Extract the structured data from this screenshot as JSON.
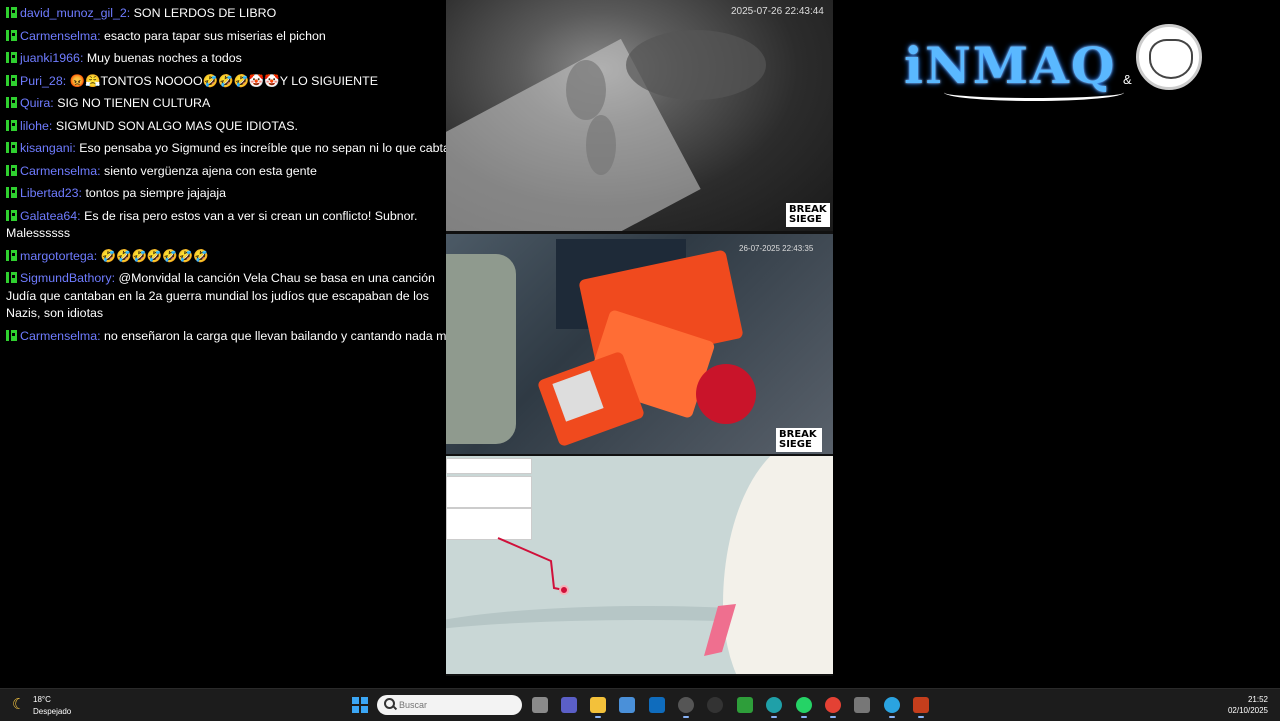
{
  "chat": {
    "messages": [
      {
        "user": "david_munoz_gil_2:",
        "text": "SON LERDOS DE LIBRO"
      },
      {
        "user": "Carmenselma:",
        "text": "esacto para tapar sus miserias el pichon"
      },
      {
        "user": "juanki1966:",
        "text": "Muy buenas noches a todos"
      },
      {
        "user": "Puri_28:",
        "text": "😡😤TONTOS NOOOO🤣🤣🤣🤡🤡Y LO SIGUIENTE"
      },
      {
        "user": "Quira:",
        "text": "SIG NO TIENEN CULTURA"
      },
      {
        "user": "lilohe:",
        "text": "SIGMUND SON ALGO MAS QUE IDIOTAS."
      },
      {
        "user": "kisangani:",
        "text": "Eso pensaba yo Sigmund es increíble que no sepan ni lo que cabtan"
      },
      {
        "user": "Carmenselma:",
        "text": "siento vergüenza ajena con esta gente"
      },
      {
        "user": "Libertad23:",
        "text": "tontos pa siempre jajajaja"
      },
      {
        "user": "Galatea64:",
        "text": "Es de risa pero estos van a ver si crean un conflicto! Subnor. Malessssss"
      },
      {
        "user": "margotortega:",
        "text": "🤣🤣🤣🤣🤣🤣🤣"
      },
      {
        "user": "SigmundBathory:",
        "text": "@Monvidal la canción Vela Chau se basa en una canción Judía que cantaban en la 2a guerra mundial los judíos que escapaban de los Nazis, son idiotas"
      },
      {
        "user": "Carmenselma:",
        "text": "no enseñaron la carga que llevan bailando y cantando nada más"
      }
    ]
  },
  "video": {
    "panel1_timestamp": "2025-07-26 22:43:44",
    "panel2_timestamp": "26-07-2025 22:43:35",
    "watermark": "BREAK SIEGE"
  },
  "brand": {
    "name": "iNMAQ",
    "amp": "&"
  },
  "taskbar": {
    "weather_temp": "18°C",
    "weather_desc": "Despejado",
    "search_placeholder": "Buscar",
    "time": "21:52",
    "date": "02/10/2025",
    "icons": [
      "task-view-icon",
      "teams-icon",
      "file-explorer-icon",
      "store-icon",
      "outlook-icon",
      "chrome-canary-icon",
      "obs-icon",
      "camtasia-icon",
      "edge-icon",
      "whatsapp-icon",
      "chrome-icon",
      "vpn-icon",
      "telegram-icon",
      "powerpoint-icon"
    ]
  },
  "colors": {
    "username": "#6f7cff",
    "kick_badge": "#2fd02f",
    "taskbar": "#1c1c1c"
  }
}
